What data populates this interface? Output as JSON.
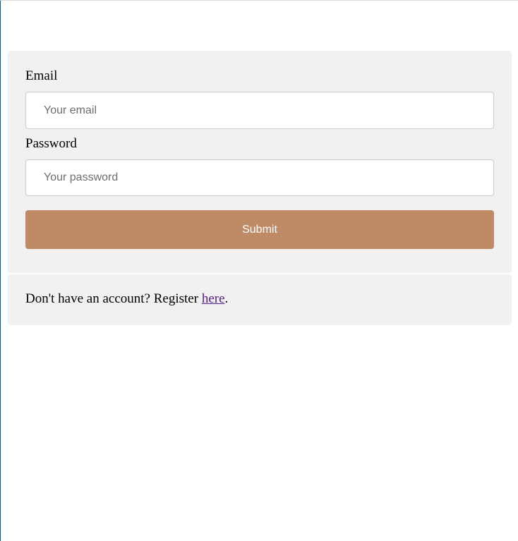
{
  "form": {
    "email_label": "Email",
    "email_placeholder": "Your email",
    "email_value": "",
    "password_label": "Password",
    "password_placeholder": "Your password",
    "password_value": "",
    "submit_label": "Submit"
  },
  "register": {
    "prompt": "Don't have an account? Register ",
    "link_text": "here",
    "suffix": "."
  },
  "colors": {
    "card_background": "#f1f1f1",
    "submit_background": "#bf8b67",
    "submit_text": "#ffffff",
    "link_visited": "#551a8b"
  }
}
